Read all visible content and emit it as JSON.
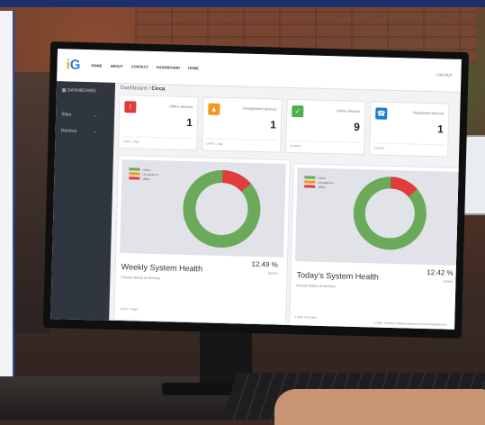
{
  "app": {
    "logo_i": "i",
    "logo_g": "G"
  },
  "nav": {
    "links": [
      "HOME",
      "ABOUT",
      "CONTACT",
      "DASHBOARD",
      "HOME"
    ],
    "right": "LOG OUT"
  },
  "sidebar": {
    "title": "DASHBOARD",
    "items": [
      {
        "label": "Sites"
      },
      {
        "label": "Devices"
      }
    ]
  },
  "breadcrumb": {
    "root": "Dashboard",
    "current": "Circa"
  },
  "cards": [
    {
      "label": "Offline devices",
      "value": "1",
      "footer": "LAST 1 day",
      "icon": "alert-icon",
      "color": "#e23b3b"
    },
    {
      "label": "Unregistered devices",
      "value": "1",
      "footer": "LAST 1 day",
      "icon": "warning-icon",
      "color": "#f39a1a"
    },
    {
      "label": "Online devices",
      "value": "9",
      "footer": "Current",
      "icon": "check-icon",
      "color": "#4cae4c"
    },
    {
      "label": "Registered devices",
      "value": "1",
      "footer": "Current",
      "icon": "phone-icon",
      "color": "#1b7bd4"
    }
  ],
  "legend": [
    {
      "name": "Online",
      "color": "#6aaa5a"
    },
    {
      "name": "Unregistered",
      "color": "#f39a1a"
    },
    {
      "name": "Offline",
      "color": "#e23b3b"
    }
  ],
  "panels": [
    {
      "title": "Weekly System Health",
      "value": "12.49 %",
      "sub": "Uptime",
      "desc": "Overall status of devices",
      "foot": "LAST 7 days"
    },
    {
      "title": "Today's System Health",
      "value": "12.42 %",
      "sub": "Uptime",
      "desc": "Overall status of devices",
      "foot": "LAST 24 hours"
    }
  ],
  "copyright": "© 2023 · Kommer. Website powered by iOrva Enterprises Inc."
}
